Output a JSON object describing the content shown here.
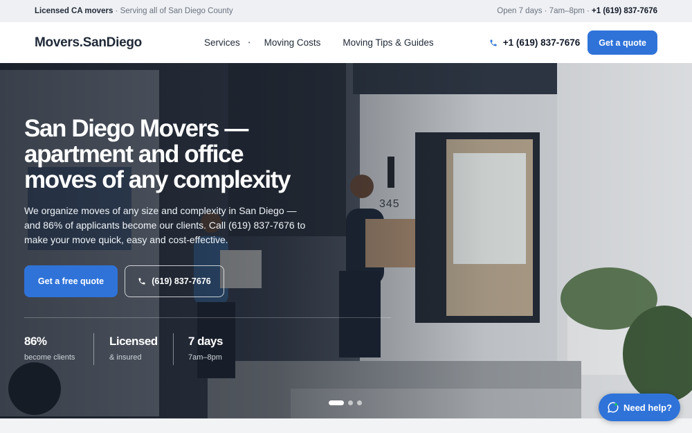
{
  "topbar": {
    "left_bold": "Licensed CA movers",
    "left_rest": " · Serving all of San Diego County",
    "right_rest": "Open 7 days · 7am–8pm · ",
    "right_bold": "+1 (619) 837-7676"
  },
  "header": {
    "logo_a": "Movers",
    "logo_dot": ".",
    "logo_b": "SanDiego",
    "nav": {
      "services": "Services",
      "costs": "Moving Costs",
      "tips": "Moving Tips & Guides"
    },
    "phone": "+1 (619) 837-7676",
    "quote_label": "Get a quote"
  },
  "hero": {
    "title": "San Diego Movers — apartment and office moves of any complexity",
    "subtitle": "We organize moves of any size and complexity in San Diego — and 86% of applicants become our clients. Call (619) 837-7676 to make your move quick, easy and cost-effective.",
    "primary_cta": "Get a free quote",
    "phone_cta": "(619) 837-7676",
    "house_number": "345",
    "stats": [
      {
        "big": "86%",
        "small": "become clients"
      },
      {
        "big": "Licensed",
        "small": "& insured"
      },
      {
        "big": "7 days",
        "small": "7am–8pm"
      }
    ],
    "slides": {
      "count": 3,
      "active": 1
    }
  },
  "help_widget": {
    "label": "Need help?"
  },
  "colors": {
    "accent": "#2f73d9",
    "topbar_bg": "#eef0f3",
    "text_dark": "#1f2937"
  },
  "icons": [
    "phone-icon",
    "chat-icon",
    "chevron-down-icon"
  ]
}
